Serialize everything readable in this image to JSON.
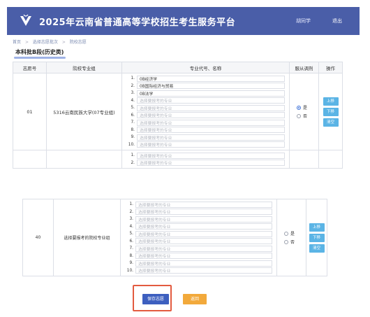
{
  "header": {
    "title": "2025年云南省普通高等学校招生考生服务平台",
    "user": "胡同学",
    "logout": "退出"
  },
  "breadcrumb": [
    "首页",
    "选择志愿批次",
    "院校志愿"
  ],
  "section_title": "本科批B段(历史类)",
  "table": {
    "headers": [
      "志愿号",
      "院校专业组",
      "专业代号、名称",
      "服从调剂",
      "操作"
    ]
  },
  "placeholder_major": "选择要报考的专业",
  "row1": {
    "number": "01",
    "school": "5316云南民族大学(07专业组)",
    "majors": [
      "0B经济学",
      "0B国际经济与贸易",
      "0B法学",
      "选择要报考的专业",
      "选择要报考的专业",
      "选择要报考的专业",
      "选择要报考的专业",
      "选择要报考的专业",
      "选择要报考的专业",
      "选择要报考的专业"
    ],
    "adjust_yes": "是",
    "adjust_no": "否",
    "adjust_selected": "是"
  },
  "row2_partial": {
    "majors": [
      "选择要报考的专业",
      "选择要报考的专业"
    ]
  },
  "row40": {
    "number": "40",
    "school": "选择要报考的院校专业组",
    "adjust_yes": "是",
    "adjust_no": "否",
    "adjust_selected": ""
  },
  "indices": [
    "1.",
    "2.",
    "3.",
    "4.",
    "5.",
    "6.",
    "7.",
    "8.",
    "9.",
    "10."
  ],
  "ops": {
    "up": "上移",
    "down": "下移",
    "clear": "清空"
  },
  "footer": {
    "save": "保存志愿",
    "back": "返回"
  },
  "colors": {
    "header_bg": "#4a5ea8",
    "op_button": "#5bb4e5",
    "save_button": "#3d5fbf",
    "back_button": "#f2a93b",
    "highlight_frame": "#e35b3f"
  }
}
